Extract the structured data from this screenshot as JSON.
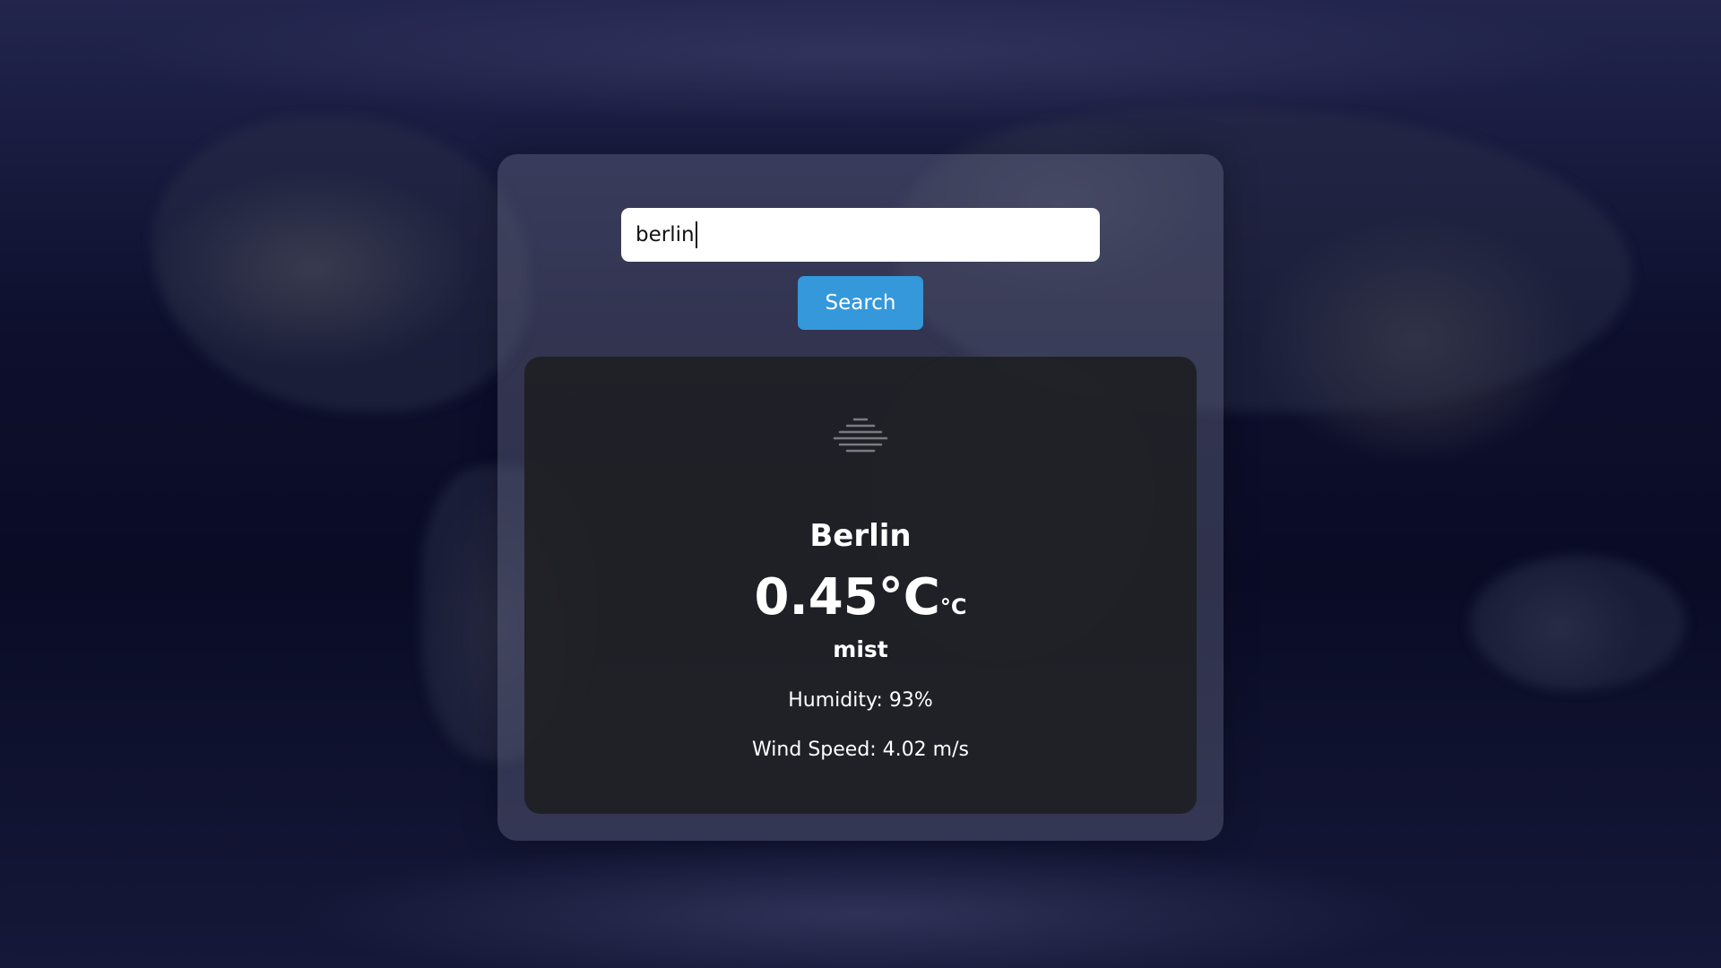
{
  "search": {
    "value": "berlin",
    "button_label": "Search"
  },
  "weather": {
    "icon": "mist-icon",
    "city": "Berlin",
    "temperature": "0.45°C",
    "temperature_unit": "°C",
    "description": "mist",
    "humidity": "Humidity: 93%",
    "wind_speed": "Wind Speed: 4.02 m/s"
  },
  "colors": {
    "button": "#3498db",
    "panel": "#1e1e22",
    "text": "#ffffff"
  }
}
